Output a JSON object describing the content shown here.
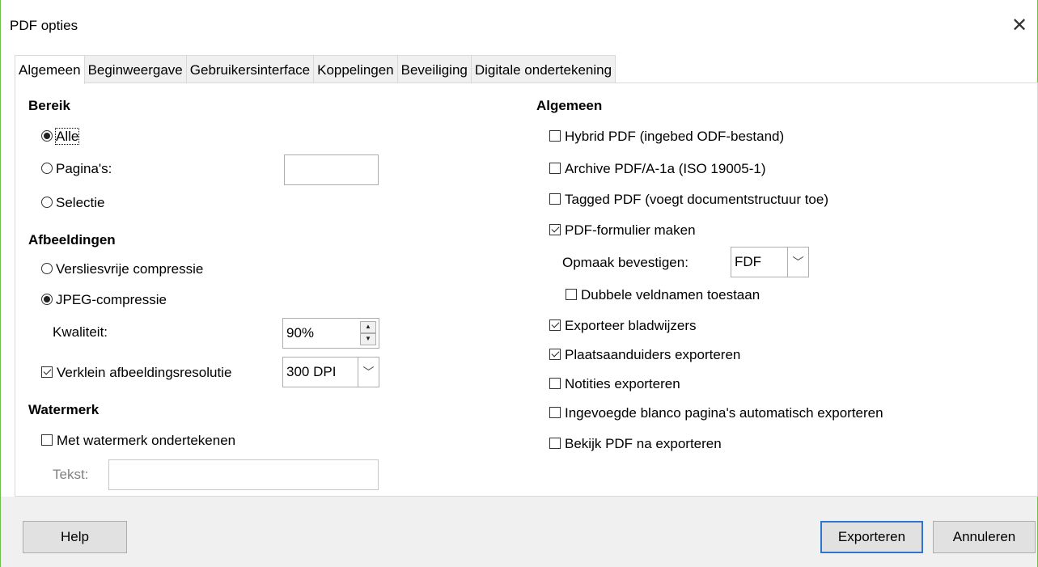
{
  "window": {
    "title": "PDF opties",
    "close_glyph": "✕"
  },
  "tabs": [
    {
      "label": "Algemeen"
    },
    {
      "label": "Beginweergave"
    },
    {
      "label": "Gebruikersinterface"
    },
    {
      "label": "Koppelingen"
    },
    {
      "label": "Beveiliging"
    },
    {
      "label": "Digitale ondertekening"
    }
  ],
  "left": {
    "bereik": {
      "heading": "Bereik",
      "all": "Alle",
      "pages": "Pagina's:",
      "pages_value": "",
      "selection": "Selectie"
    },
    "images": {
      "heading": "Afbeeldingen",
      "lossless": "Versliesvrije compressie",
      "jpeg": "JPEG-compressie",
      "quality_label": "Kwaliteit:",
      "quality_value": "90%",
      "reduce_label": "Verklein afbeeldingsresolutie",
      "resolution_value": "300 DPI"
    },
    "watermark": {
      "heading": "Watermerk",
      "sign_label": "Met watermerk ondertekenen",
      "text_label": "Tekst:",
      "text_value": ""
    }
  },
  "right": {
    "heading": "Algemeen",
    "hybrid": "Hybrid PDF (ingebed ODF-bestand)",
    "archive": "Archive PDF/A-1a (ISO 19005-1)",
    "tagged": "Tagged PDF (voegt documentstructuur toe)",
    "form": "PDF-formulier maken",
    "submit_label": "Opmaak bevestigen:",
    "submit_value": "FDF",
    "duplicate": "Dubbele veldnamen toestaan",
    "bookmarks": "Exporteer bladwijzers",
    "placeholders": "Plaatsaanduiders exporteren",
    "notes": "Notities exporteren",
    "blank": "Ingevoegde blanco pagina's automatisch exporteren",
    "view": "Bekijk PDF na exporteren"
  },
  "buttons": {
    "help": "Help",
    "export": "Exporteren",
    "cancel": "Annuleren"
  }
}
